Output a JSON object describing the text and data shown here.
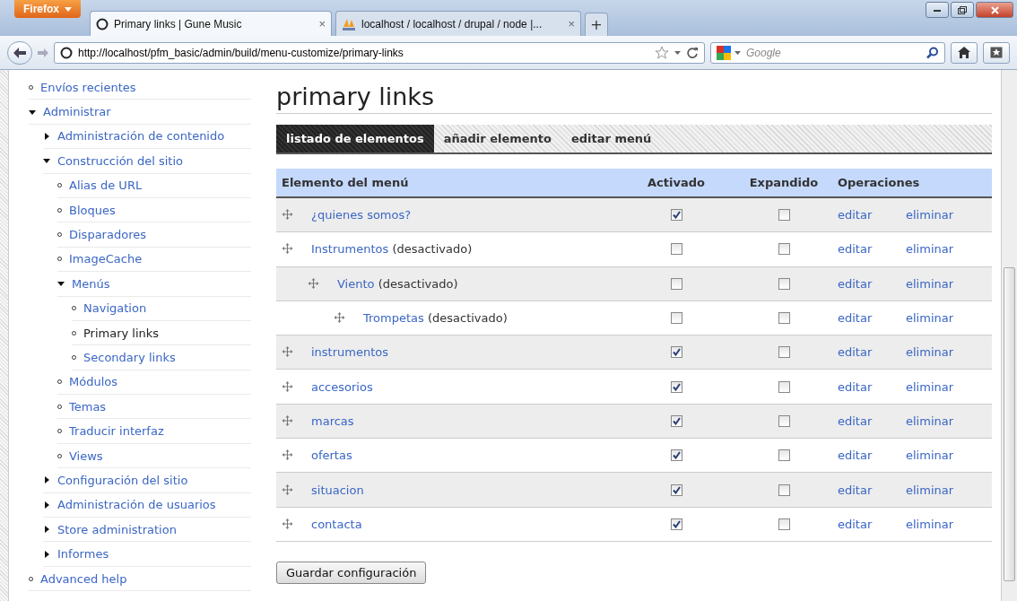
{
  "browser": {
    "menu_button": "Firefox",
    "tabs": [
      {
        "label": "Primary links | Gune Music",
        "selected": true,
        "close": "×"
      },
      {
        "label": "localhost / localhost / drupal / node |...",
        "selected": false,
        "close": "×"
      }
    ],
    "new_tab": "+",
    "url": "http://localhost/pfm_basic/admin/build/menu-customize/primary-links",
    "search": {
      "placeholder": "Google"
    }
  },
  "sidebar": {
    "items": [
      {
        "label": "Envíos recientes",
        "selected": false
      },
      {
        "label": "Administrar",
        "selected": false,
        "expanded": true,
        "children": [
          {
            "label": "Administración de contenido",
            "selected": false,
            "expanded": false
          },
          {
            "label": "Construcción del sitio",
            "selected": false,
            "expanded": true,
            "children": [
              {
                "label": "Alias de URL",
                "selected": false
              },
              {
                "label": "Bloques",
                "selected": false
              },
              {
                "label": "Disparadores",
                "selected": false
              },
              {
                "label": "ImageCache",
                "selected": false
              },
              {
                "label": "Menús",
                "selected": false,
                "expanded": true,
                "children": [
                  {
                    "label": "Navigation",
                    "selected": false
                  },
                  {
                    "label": "Primary links",
                    "selected": true
                  },
                  {
                    "label": "Secondary links",
                    "selected": false
                  }
                ]
              },
              {
                "label": "Módulos",
                "selected": false
              },
              {
                "label": "Temas",
                "selected": false
              },
              {
                "label": "Traducir interfaz",
                "selected": false
              },
              {
                "label": "Views",
                "selected": false
              }
            ]
          },
          {
            "label": "Configuración del sitio",
            "selected": false,
            "expanded": false
          },
          {
            "label": "Administración de usuarios",
            "selected": false,
            "expanded": false
          },
          {
            "label": "Store administration",
            "selected": false,
            "expanded": false
          },
          {
            "label": "Informes",
            "selected": false,
            "expanded": false
          }
        ]
      },
      {
        "label": "Advanced help",
        "selected": false
      }
    ]
  },
  "page_title": "primary links",
  "tabs": [
    {
      "label": "listado de elementos",
      "selected": true
    },
    {
      "label": "añadir elemento",
      "selected": false
    },
    {
      "label": "editar menú",
      "selected": false
    }
  ],
  "table": {
    "columns": [
      "Elemento del menú",
      "Activado",
      "Expandido",
      "Operaciones"
    ],
    "rows": [
      {
        "title": "¿quienes somos?",
        "activated": true,
        "expanded": false,
        "edit": "editar",
        "delete": "eliminar"
      },
      {
        "title": "Instrumentos",
        "note": "(desactivado)",
        "activated": false,
        "expanded": false,
        "edit": "editar",
        "delete": "eliminar",
        "children": [
          {
            "title": "Viento",
            "note": "(desactivado)",
            "activated": false,
            "expanded": false,
            "edit": "editar",
            "delete": "eliminar",
            "children": [
              {
                "title": "Trompetas",
                "note": "(desactivado)",
                "activated": false,
                "expanded": false,
                "edit": "editar",
                "delete": "eliminar"
              }
            ]
          }
        ]
      },
      {
        "title": "instrumentos",
        "activated": true,
        "expanded": false,
        "edit": "editar",
        "delete": "eliminar"
      },
      {
        "title": "accesorios",
        "activated": true,
        "expanded": false,
        "edit": "editar",
        "delete": "eliminar"
      },
      {
        "title": "marcas",
        "activated": true,
        "expanded": false,
        "edit": "editar",
        "delete": "eliminar"
      },
      {
        "title": "ofertas",
        "activated": true,
        "expanded": false,
        "edit": "editar",
        "delete": "eliminar"
      },
      {
        "title": "situacion",
        "activated": true,
        "expanded": false,
        "edit": "editar",
        "delete": "eliminar"
      },
      {
        "title": "contacta",
        "activated": true,
        "expanded": false,
        "edit": "editar",
        "delete": "eliminar"
      }
    ]
  },
  "save_button": "Guardar configuración"
}
